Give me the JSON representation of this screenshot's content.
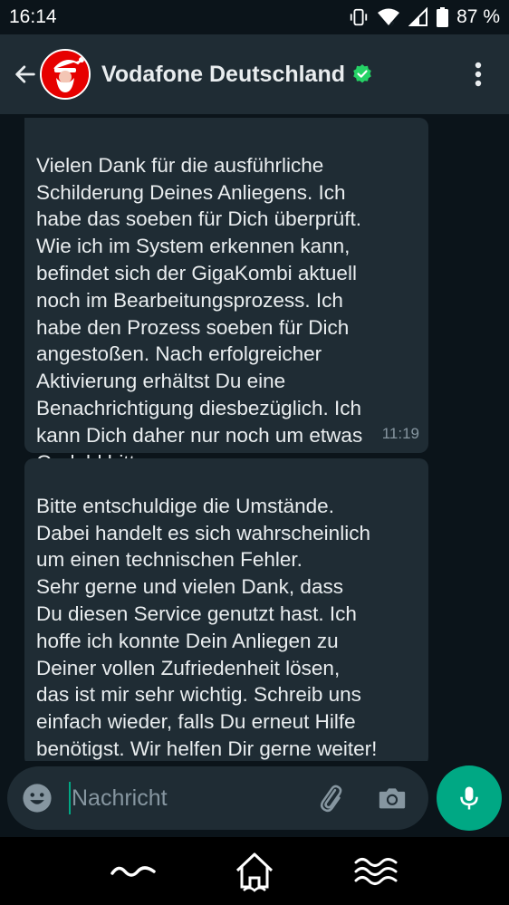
{
  "status_bar": {
    "time": "16:14",
    "battery": "87 %",
    "icons": [
      "vibrate-icon",
      "wifi-icon",
      "signal-icon",
      "battery-icon"
    ]
  },
  "header": {
    "contact_name": "Vodafone Deutschland",
    "verified_color": "#25d366",
    "avatar_icon": "santa-icon"
  },
  "messages": [
    {
      "text": "Vielen Dank für die ausführliche\nSchilderung Deines Anliegens. Ich\nhabe das soeben für Dich überprüft.\nWie ich im System erkennen kann,\nbefindet sich der GigaKombi aktuell\nnoch im Bearbeitungsprozess. Ich\nhabe den Prozess soeben für Dich\nangestoßen. Nach erfolgreicher\nAktivierung erhältst Du eine\nBenachrichtigung diesbezüglich. Ich\nkann Dich daher nur noch um etwas\nGeduld bitten.",
      "time": "11:19"
    },
    {
      "text": "Bitte entschuldige die Umstände.\nDabei handelt es sich wahrscheinlich\num einen technischen Fehler.\nSehr gerne und vielen Dank, dass\nDu diesen Service genutzt hast. Ich\nhoffe ich konnte Dein Anliegen zu\nDeiner vollen Zufriedenheit lösen,\ndas ist mir sehr wichtig. Schreib uns\neinfach wieder, falls Du erneut Hilfe\nbenötigst. Wir helfen Dir gerne weiter!"
    }
  ],
  "composer": {
    "placeholder": "Nachricht"
  },
  "colors": {
    "background": "#0b141a",
    "bubble": "#1f2c34",
    "accent": "#00a884",
    "vodafone_red": "#e60000"
  }
}
